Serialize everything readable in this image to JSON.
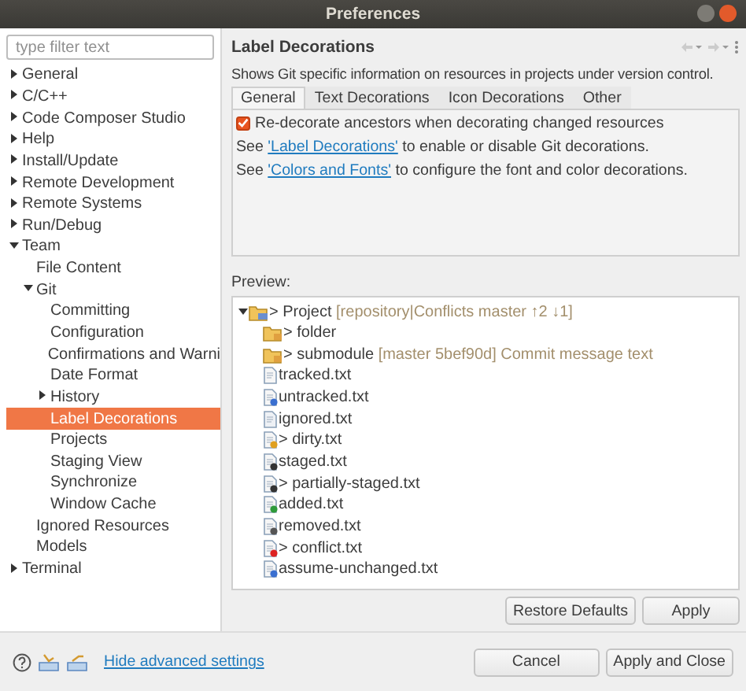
{
  "window": {
    "title": "Preferences"
  },
  "filter": {
    "placeholder": "type filter text"
  },
  "sidebar": {
    "items": [
      {
        "label": "General",
        "expanded": false,
        "selected": false
      },
      {
        "label": "C/C++",
        "expanded": false,
        "selected": false
      },
      {
        "label": "Code Composer Studio",
        "expanded": false,
        "selected": false
      },
      {
        "label": "Help",
        "expanded": false,
        "selected": false
      },
      {
        "label": "Install/Update",
        "expanded": false,
        "selected": false
      },
      {
        "label": "Remote Development",
        "expanded": false,
        "selected": false
      },
      {
        "label": "Remote Systems",
        "expanded": false,
        "selected": false
      },
      {
        "label": "Run/Debug",
        "expanded": false,
        "selected": false
      },
      {
        "label": "Team",
        "expanded": true,
        "selected": false,
        "children": [
          {
            "label": "File Content",
            "selected": false
          },
          {
            "label": "Git",
            "expanded": true,
            "selected": false,
            "children": [
              {
                "label": "Committing",
                "selected": false
              },
              {
                "label": "Configuration",
                "selected": false
              },
              {
                "label": "Confirmations and Warni",
                "selected": false
              },
              {
                "label": "Date Format",
                "selected": false
              },
              {
                "label": "History",
                "expanded": false,
                "selected": false
              },
              {
                "label": "Label Decorations",
                "selected": true
              },
              {
                "label": "Projects",
                "selected": false
              },
              {
                "label": "Staging View",
                "selected": false
              },
              {
                "label": "Synchronize",
                "selected": false
              },
              {
                "label": "Window Cache",
                "selected": false
              }
            ]
          },
          {
            "label": "Ignored Resources",
            "selected": false
          },
          {
            "label": "Models",
            "selected": false
          }
        ]
      },
      {
        "label": "Terminal",
        "expanded": false,
        "selected": false
      }
    ]
  },
  "page": {
    "title": "Label Decorations",
    "description": "Shows Git specific information on resources in projects under version control.",
    "tabs": [
      {
        "label": "General",
        "selected": true
      },
      {
        "label": "Text Decorations",
        "selected": false
      },
      {
        "label": "Icon Decorations",
        "selected": false
      },
      {
        "label": "Other",
        "selected": false
      }
    ],
    "checkbox": {
      "label": "Re-decorate ancestors when decorating changed resources",
      "checked": true
    },
    "links": [
      {
        "before": "See ",
        "link": "'Label Decorations'",
        "after": " to enable or disable Git decorations."
      },
      {
        "before": "See ",
        "link": "'Colors and Fonts'",
        "after": " to configure the font and color decorations."
      }
    ],
    "preview_label": "Preview:",
    "preview": [
      {
        "kind": "project",
        "prefix": "> ",
        "name": "Project",
        "decoration": "[repository|Conflicts master ↑2 ↓1]",
        "expanded": true,
        "children": [
          {
            "kind": "folder",
            "prefix": "> ",
            "name": "folder"
          },
          {
            "kind": "folder",
            "prefix": "> ",
            "name": "submodule",
            "decoration": "[master 5bef90d] Commit message text"
          },
          {
            "kind": "tracked",
            "name": "tracked.txt"
          },
          {
            "kind": "untracked",
            "name": "untracked.txt"
          },
          {
            "kind": "ignored",
            "name": "ignored.txt"
          },
          {
            "kind": "dirty",
            "prefix": "> ",
            "name": "dirty.txt"
          },
          {
            "kind": "staged",
            "name": "staged.txt"
          },
          {
            "kind": "staged",
            "prefix": "> ",
            "name": "partially-staged.txt"
          },
          {
            "kind": "added",
            "name": "added.txt"
          },
          {
            "kind": "removed",
            "name": "removed.txt"
          },
          {
            "kind": "conflict",
            "prefix": "> ",
            "name": "conflict.txt"
          },
          {
            "kind": "assumed",
            "name": "assume-unchanged.txt"
          }
        ]
      }
    ],
    "buttons": [
      "Restore Defaults",
      "Apply"
    ]
  },
  "footer": {
    "link": "Hide advanced settings",
    "buttons": [
      "Cancel",
      "Apply and Close"
    ]
  }
}
